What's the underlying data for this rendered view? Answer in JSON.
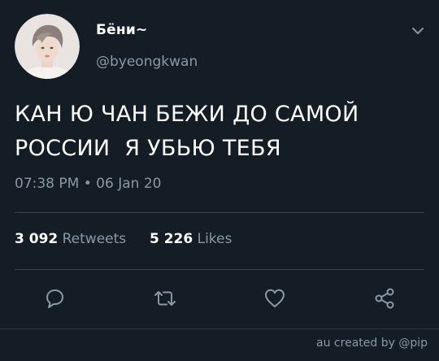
{
  "tweet": {
    "display_name": "Бёни~",
    "handle": "@byeongkwan",
    "text_line1": "КАН Ю ЧАН БЕЖИ ДО САМОЙ",
    "text_line2": "РОССИИ  Я УБЬЮ ТЕБЯ",
    "time": "07:38 PM",
    "separator": " • ",
    "date": "06 Jan 20",
    "retweets_count": "3 092",
    "retweets_label": " Retweets",
    "likes_count": "5 226",
    "likes_label": " Likes"
  },
  "icons": {
    "menu": "chevron-down-icon",
    "reply": "reply-icon",
    "retweet": "retweet-icon",
    "like": "heart-icon",
    "share": "share-icon"
  },
  "footer": {
    "credit": "au created by @pip"
  },
  "colors": {
    "background": "#141d26",
    "secondary_text": "#8899a6",
    "divider": "#38444d"
  }
}
